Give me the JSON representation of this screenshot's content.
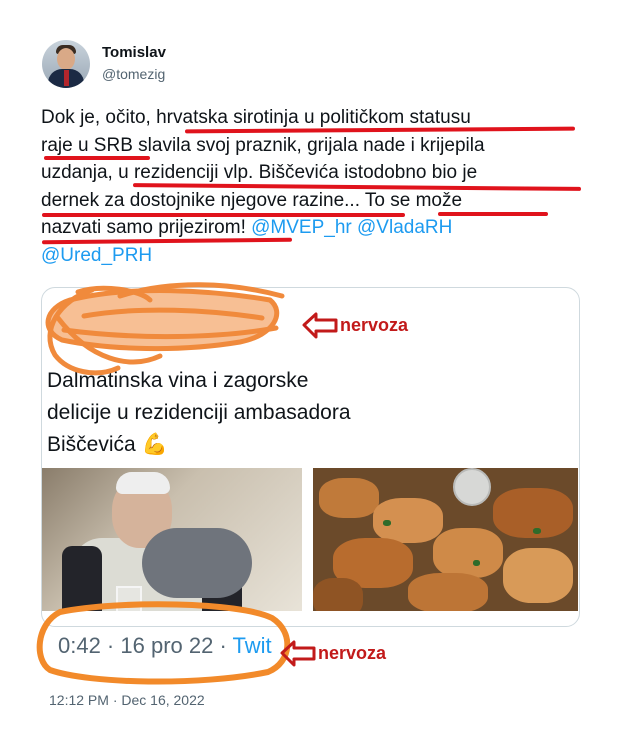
{
  "author": {
    "name": "Tomislav",
    "handle": "@tomezig"
  },
  "tweet": {
    "line1": "Dok je, očito, hrvatska sirotinja u političkom statusu",
    "line2": "raje u SRB slavila svoj praznik, grijala nade i krijepila",
    "line3": "uzdanja, u rezidenciji vlp. Biščevića istodobno bio je",
    "line4": "dernek za dostojnike njegove razine... To se može",
    "line5a": "nazvati samo prijezirom!",
    "mention1": "@MVEP_hr",
    "mention2": "@VladaRH",
    "mention3": "@Ured_PRH"
  },
  "quoted": {
    "text_line1": "Dalmatinska vina i zagorske",
    "text_line2": "delicije u rezidenciji ambasadora",
    "text_line3": "Biščevića 💪",
    "meta_time": "0:42 · 16 pro 22 · ",
    "meta_source": "Twit"
  },
  "annotations": {
    "label1": "nervoza",
    "label2": "nervoza"
  },
  "footer": {
    "timestamp": "12:12 PM · Dec 16, 2022"
  },
  "colors": {
    "underline": "#e0131c",
    "scribble": "#f08a3c",
    "link": "#1d9bf0",
    "annotation": "#c21a1a"
  }
}
